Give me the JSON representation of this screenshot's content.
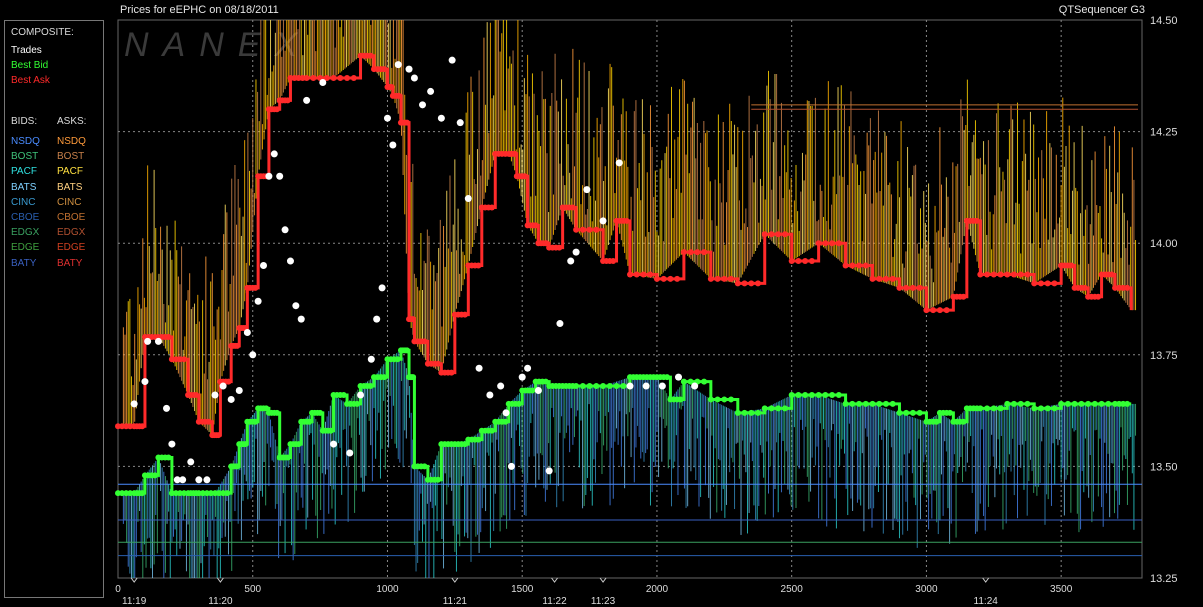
{
  "header": {
    "title_left": "Prices for  eEPHC  on  08/18/2011",
    "title_right": "QTSequencer G3"
  },
  "watermark": "NANEX",
  "legend": {
    "composite_heading": "COMPOSITE:",
    "composite": [
      {
        "label": "Trades",
        "color": "#ffffff"
      },
      {
        "label": "Best Bid",
        "color": "#33ff33"
      },
      {
        "label": "Best Ask",
        "color": "#ff2a2a"
      }
    ],
    "bids_heading": "BIDS:",
    "asks_heading": "ASKS:",
    "bids": [
      {
        "label": "NSDQ",
        "color": "#4a8cff"
      },
      {
        "label": "BOST",
        "color": "#3fc27a"
      },
      {
        "label": "PACF",
        "color": "#2fe0e0"
      },
      {
        "label": "BATS",
        "color": "#7fd0ff"
      },
      {
        "label": "CINC",
        "color": "#3a9ad0"
      },
      {
        "label": "CBOE",
        "color": "#2a5fb0"
      },
      {
        "label": "EDGX",
        "color": "#3aa060"
      },
      {
        "label": "EDGE",
        "color": "#40a040"
      },
      {
        "label": "BATY",
        "color": "#3a60c0"
      }
    ],
    "asks": [
      {
        "label": "NSDQ",
        "color": "#ff9a3a"
      },
      {
        "label": "BOST",
        "color": "#c8804a"
      },
      {
        "label": "PACF",
        "color": "#ffe040"
      },
      {
        "label": "BATS",
        "color": "#ffd080"
      },
      {
        "label": "CINC",
        "color": "#d09040"
      },
      {
        "label": "CBOE",
        "color": "#c07030"
      },
      {
        "label": "EDGX",
        "color": "#b05030"
      },
      {
        "label": "EDGE",
        "color": "#d04020"
      },
      {
        "label": "BATY",
        "color": "#e03030"
      }
    ]
  },
  "chart_data": {
    "type": "line",
    "xlim": [
      0,
      3800
    ],
    "ylim": [
      13.25,
      14.5
    ],
    "x_ticks": [
      0,
      500,
      1000,
      1500,
      2000,
      2500,
      3000,
      3500
    ],
    "y_ticks": [
      13.25,
      13.5,
      13.75,
      14.0,
      14.25,
      14.5
    ],
    "y_tick_labels": [
      "13.25",
      "13.50",
      "13.75",
      "14.00",
      "14.25",
      "14.50"
    ],
    "time_labels": [
      {
        "x": 60,
        "label": "11:19"
      },
      {
        "x": 380,
        "label": "11:20"
      },
      {
        "x": 1250,
        "label": "11:21"
      },
      {
        "x": 1620,
        "label": "11:22"
      },
      {
        "x": 1800,
        "label": "11:23"
      },
      {
        "x": 3220,
        "label": "11:24"
      }
    ],
    "series": [
      {
        "name": "Best Ask",
        "color": "#ff2a2a",
        "x": [
          0,
          60,
          100,
          150,
          200,
          260,
          300,
          350,
          380,
          420,
          450,
          480,
          520,
          560,
          600,
          640,
          700,
          800,
          900,
          950,
          1000,
          1020,
          1050,
          1080,
          1100,
          1150,
          1200,
          1250,
          1300,
          1350,
          1400,
          1450,
          1480,
          1520,
          1560,
          1600,
          1650,
          1700,
          1800,
          1850,
          1900,
          2000,
          2100,
          2200,
          2300,
          2400,
          2500,
          2600,
          2700,
          2800,
          2900,
          3000,
          3100,
          3150,
          3200,
          3300,
          3400,
          3500,
          3550,
          3600,
          3650,
          3700,
          3760
        ],
        "y": [
          13.59,
          13.59,
          13.79,
          13.79,
          13.74,
          13.66,
          13.6,
          13.57,
          13.69,
          13.77,
          13.81,
          13.9,
          14.15,
          14.3,
          14.32,
          14.37,
          14.37,
          14.37,
          14.42,
          14.39,
          14.35,
          14.33,
          14.27,
          13.83,
          13.78,
          13.73,
          13.71,
          13.84,
          13.95,
          14.08,
          14.2,
          14.2,
          14.15,
          14.04,
          14.0,
          13.99,
          14.08,
          14.03,
          13.96,
          14.05,
          13.93,
          13.92,
          13.98,
          13.92,
          13.91,
          14.02,
          13.96,
          14.0,
          13.95,
          13.92,
          13.9,
          13.85,
          13.88,
          14.05,
          13.93,
          13.93,
          13.91,
          13.95,
          13.9,
          13.88,
          13.93,
          13.9,
          13.85
        ]
      },
      {
        "name": "Best Bid",
        "color": "#33ff33",
        "x": [
          0,
          60,
          100,
          150,
          200,
          260,
          300,
          360,
          420,
          450,
          480,
          520,
          560,
          600,
          640,
          680,
          720,
          760,
          800,
          850,
          900,
          950,
          1000,
          1050,
          1080,
          1100,
          1150,
          1200,
          1250,
          1300,
          1350,
          1400,
          1450,
          1500,
          1550,
          1600,
          1650,
          1700,
          1800,
          1900,
          1950,
          2000,
          2050,
          2100,
          2200,
          2300,
          2400,
          2500,
          2600,
          2700,
          2800,
          2900,
          3000,
          3050,
          3100,
          3150,
          3200,
          3300,
          3400,
          3500,
          3600,
          3700,
          3760
        ],
        "y": [
          13.44,
          13.44,
          13.48,
          13.52,
          13.44,
          13.44,
          13.44,
          13.44,
          13.5,
          13.55,
          13.6,
          13.63,
          13.62,
          13.52,
          13.55,
          13.6,
          13.62,
          13.58,
          13.66,
          13.64,
          13.68,
          13.7,
          13.74,
          13.76,
          13.7,
          13.5,
          13.47,
          13.55,
          13.55,
          13.56,
          13.58,
          13.6,
          13.64,
          13.67,
          13.69,
          13.68,
          13.68,
          13.68,
          13.68,
          13.7,
          13.7,
          13.7,
          13.65,
          13.69,
          13.65,
          13.62,
          13.63,
          13.66,
          13.66,
          13.64,
          13.64,
          13.62,
          13.6,
          13.62,
          13.6,
          13.63,
          13.63,
          13.64,
          13.63,
          13.64,
          13.64,
          13.64,
          13.64
        ]
      },
      {
        "name": "Trades",
        "color": "#ffffff",
        "x": [
          60,
          100,
          110,
          150,
          180,
          200,
          220,
          240,
          270,
          300,
          330,
          360,
          390,
          420,
          450,
          480,
          500,
          520,
          540,
          560,
          580,
          600,
          620,
          640,
          660,
          680,
          700,
          760,
          800,
          860,
          900,
          940,
          960,
          980,
          1000,
          1020,
          1040,
          1080,
          1100,
          1130,
          1160,
          1200,
          1240,
          1270,
          1300,
          1340,
          1380,
          1420,
          1440,
          1460,
          1500,
          1520,
          1560,
          1600,
          1640,
          1680,
          1700,
          1740,
          1800,
          1860,
          1900,
          1960,
          2020,
          2080,
          2140
        ],
        "y": [
          13.64,
          13.69,
          13.78,
          13.78,
          13.63,
          13.55,
          13.47,
          13.47,
          13.51,
          13.47,
          13.47,
          13.66,
          13.68,
          13.65,
          13.67,
          13.8,
          13.75,
          13.87,
          13.95,
          14.15,
          14.2,
          14.15,
          14.03,
          13.96,
          13.86,
          13.83,
          14.32,
          14.36,
          13.55,
          13.53,
          13.66,
          13.74,
          13.83,
          13.9,
          14.28,
          14.22,
          14.4,
          14.39,
          14.37,
          14.31,
          14.34,
          14.28,
          14.41,
          14.27,
          14.1,
          13.72,
          13.66,
          13.68,
          13.62,
          13.5,
          13.7,
          13.72,
          13.67,
          13.49,
          13.82,
          13.96,
          13.98,
          14.12,
          14.05,
          14.18,
          13.68,
          13.68,
          13.68,
          13.7,
          13.68
        ]
      }
    ]
  }
}
